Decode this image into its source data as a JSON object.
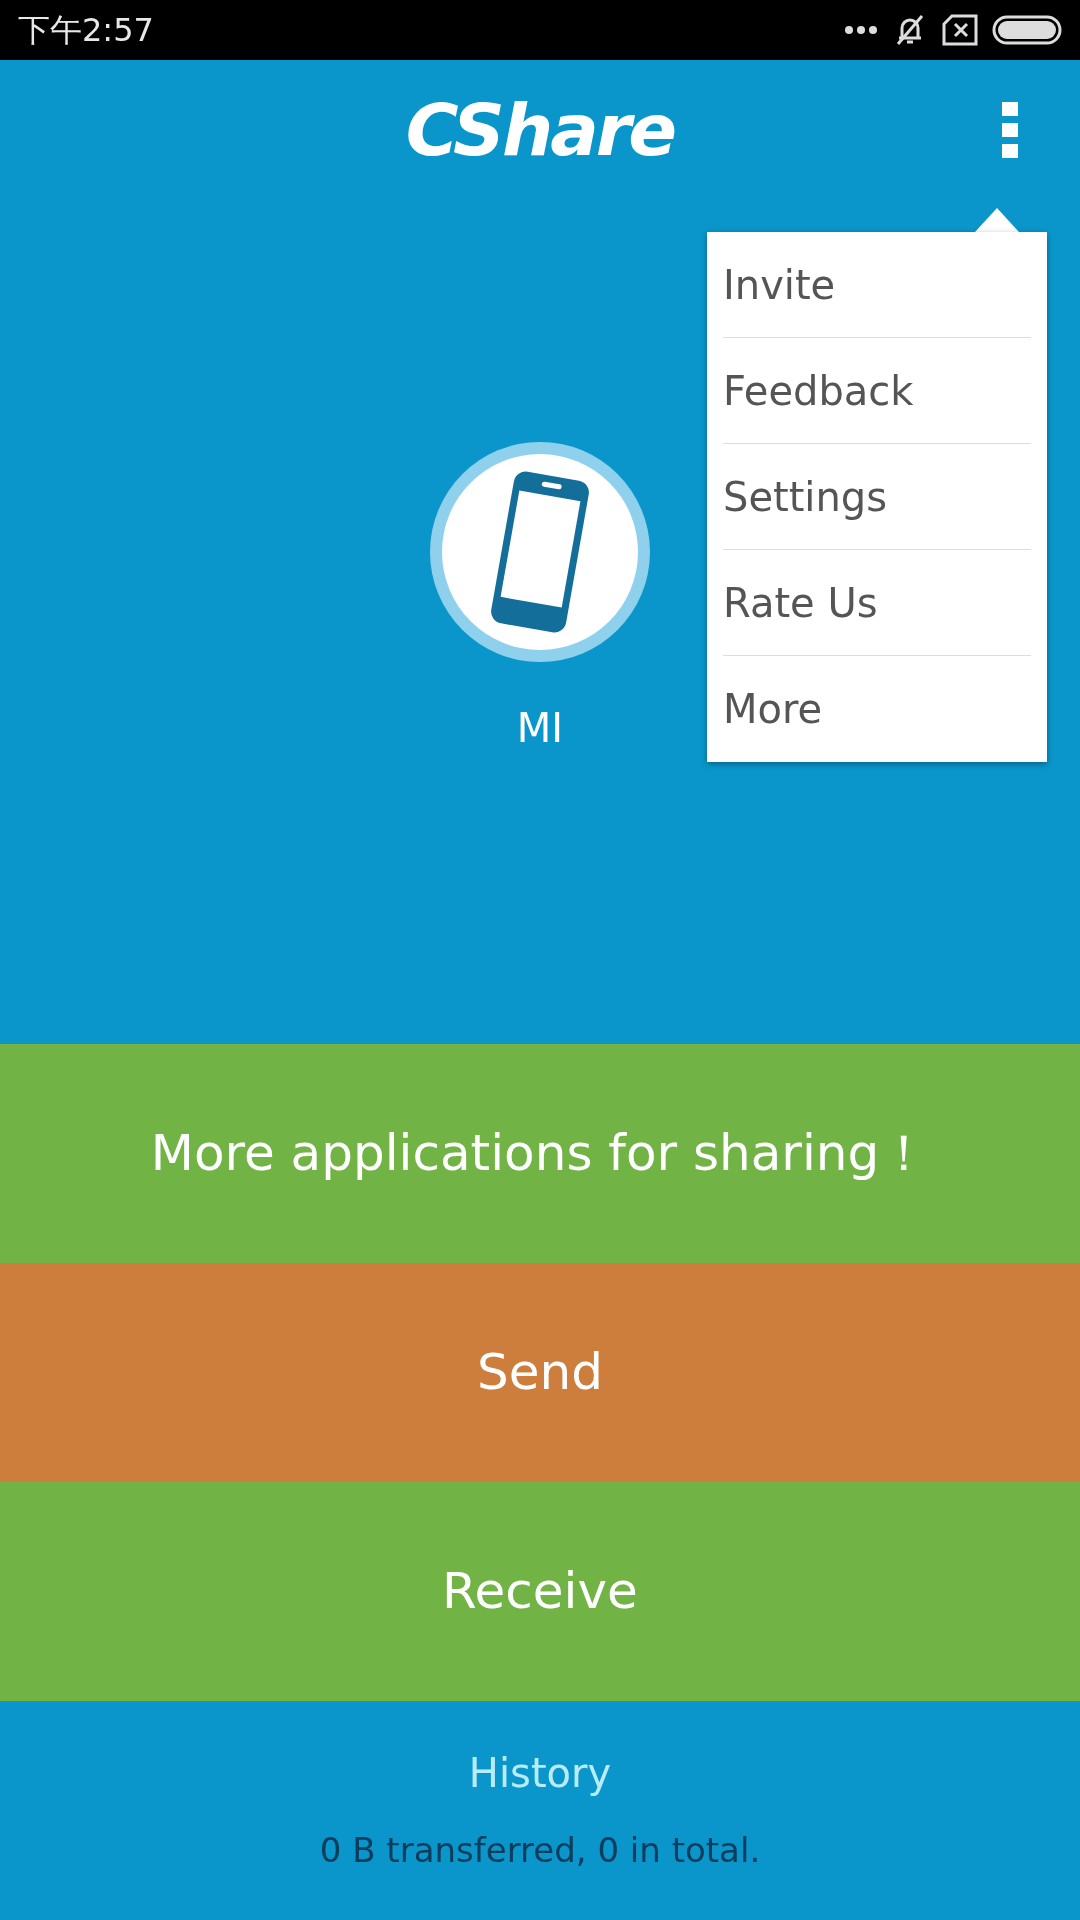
{
  "status_bar": {
    "time": "下午2:57"
  },
  "header": {
    "logo": "CShare"
  },
  "device": {
    "name": "MI"
  },
  "menu": {
    "items": [
      {
        "label": "Invite"
      },
      {
        "label": "Feedback"
      },
      {
        "label": "Settings"
      },
      {
        "label": "Rate Us"
      },
      {
        "label": "More"
      }
    ]
  },
  "actions": [
    {
      "label": "More applications for sharing！",
      "color": "#72b345"
    },
    {
      "label": "Send",
      "color": "#cd7e3d"
    },
    {
      "label": "Receive",
      "color": "#72b345"
    }
  ],
  "history": {
    "title": "History",
    "summary": "0 B transferred, 0 in total."
  }
}
